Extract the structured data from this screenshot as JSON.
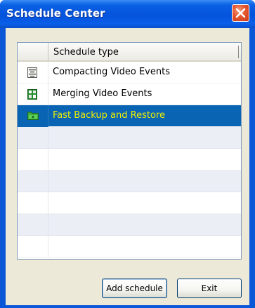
{
  "window": {
    "title": "Schedule Center",
    "close_icon": "close-icon",
    "accent_color": "#0a57d8",
    "close_color": "#e5572e"
  },
  "grid": {
    "column_header": "Schedule type",
    "rows": [
      {
        "label": "Compacting Video Events",
        "icon": "compact-icon",
        "selected": false
      },
      {
        "label": "Merging Video Events",
        "icon": "merge-icon",
        "selected": false
      },
      {
        "label": "Fast Backup and Restore",
        "icon": "folder-icon",
        "selected": true
      }
    ],
    "selected_row_color": "#0a64b4",
    "selected_text_color": "#f0f000"
  },
  "buttons": {
    "add_schedule": "Add schedule",
    "exit": "Exit"
  }
}
